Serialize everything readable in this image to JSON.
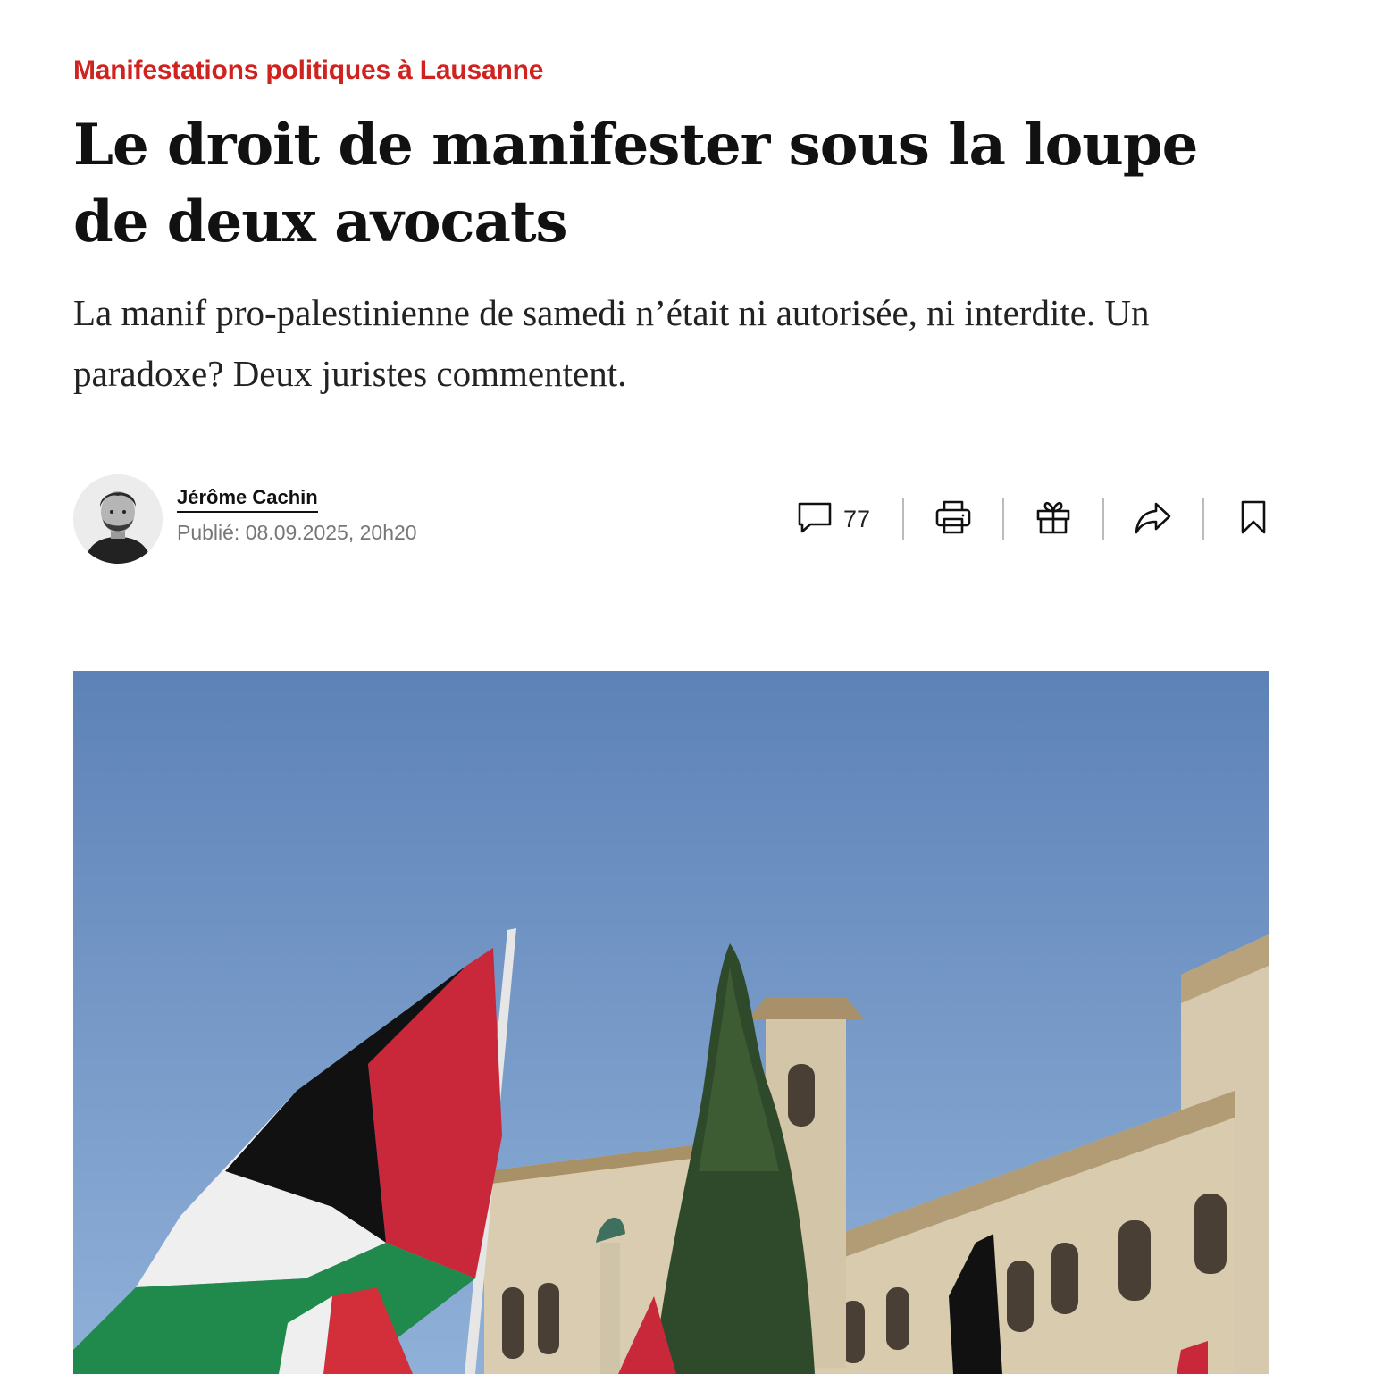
{
  "article": {
    "kicker": "Manifestations politiques à Lausanne",
    "headline": "Le droit de manifester sous la loupe de deux avocats",
    "lead": "La manif pro-palestinienne de samedi n’était ni autorisée, ni interdite. Un paradoxe? Deux juristes commentent."
  },
  "byline": {
    "author": "Jérôme Cachin",
    "published": "Publié: 08.09.2025, 20h20"
  },
  "toolbar": {
    "comment_count": "77",
    "icons": [
      "comment-icon",
      "print-icon",
      "gift-icon",
      "share-icon",
      "bookmark-icon"
    ]
  },
  "colors": {
    "kicker": "#d0231f",
    "text": "#111111"
  }
}
